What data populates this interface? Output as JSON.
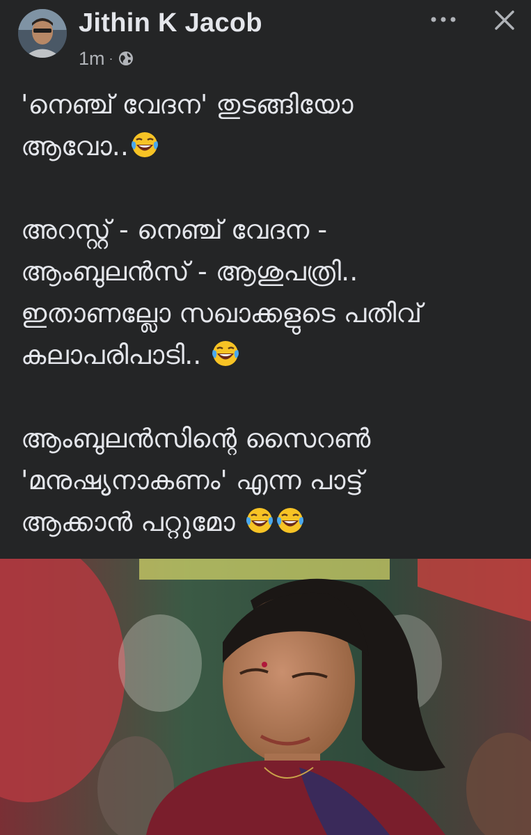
{
  "post": {
    "author": "Jithin K Jacob",
    "time": "1m",
    "time_separator": "·",
    "privacy_icon": "globe-icon",
    "lines": [
      "'നെഞ്ച് വേദന' തുടങ്ങിയോ",
      "ആവോ..",
      "",
      "അറസ്റ്റ് - നെഞ്ച് വേദന -",
      "ആംബുലൻസ് - ആശുപത്രി..",
      "ഇതാണല്ലോ സഖാക്കളുടെ പതിവ്",
      "കലാപരിപാടി.. ",
      "",
      "ആംബുലൻസിന്റെ സൈറൺ",
      "'മനുഷ്യനാകണം' എന്ന പാട്ട്",
      "ആക്കാൻ പറ്റുമോ "
    ]
  },
  "colors": {
    "background": "#242526",
    "text_primary": "#e4e6eb",
    "text_secondary": "#b0b3b8",
    "emoji_face": "#f7c325"
  },
  "icons": {
    "more": "more-horizontal-icon",
    "close": "close-icon",
    "emoji": "face-with-tears-of-joy-icon"
  }
}
